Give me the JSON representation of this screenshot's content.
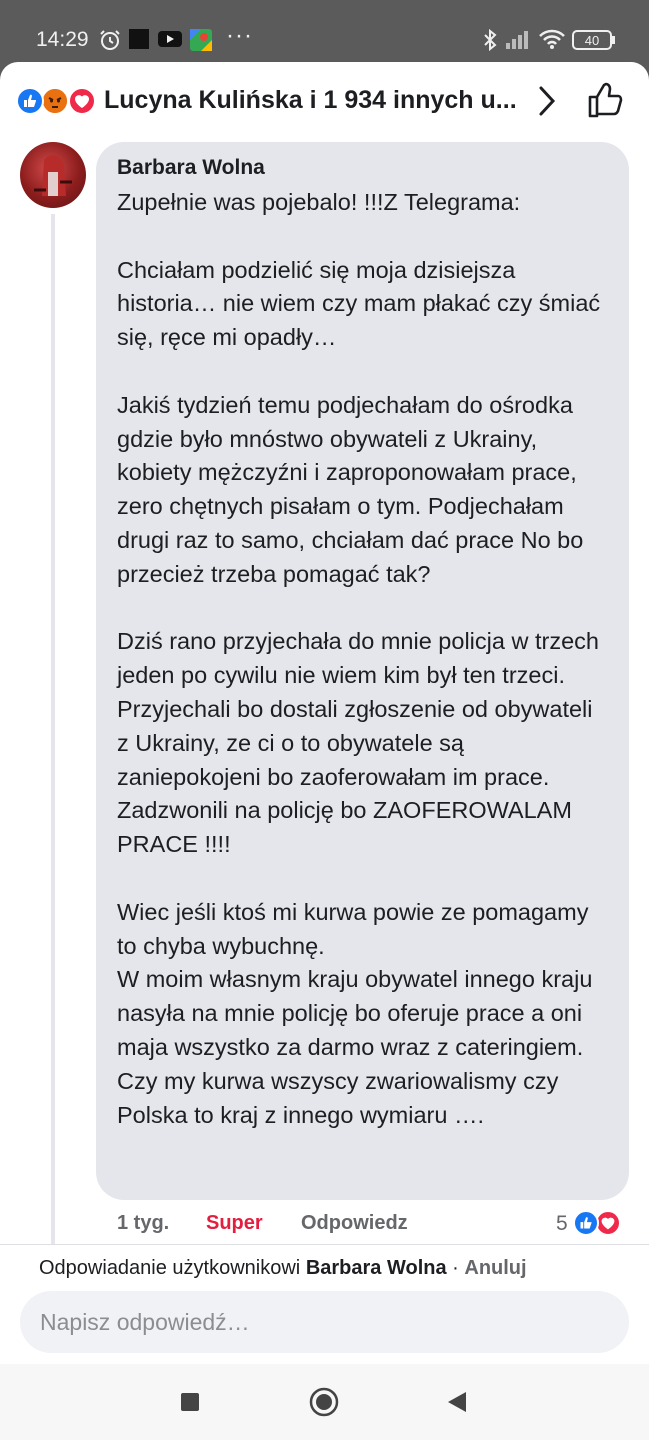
{
  "status_bar": {
    "time": "14:29",
    "dots": "···",
    "battery": "40",
    "icons": [
      "alarm-icon",
      "notification-square-icon",
      "youtube-icon",
      "maps-icon",
      "bluetooth-icon",
      "signal-icon",
      "wifi-icon",
      "battery-icon"
    ]
  },
  "header": {
    "title": "Lucyna Kulińska i 1 934 innych u...",
    "reaction_icons": [
      "like-reaction-icon",
      "angry-reaction-icon",
      "love-reaction-icon"
    ]
  },
  "comment": {
    "author": "Barbara Wolna",
    "text": "Zupełnie was pojebalo! !!!Z Telegrama:\n\nChciałam podzielić się moja dzisiejsza historia… nie wiem czy mam płakać czy śmiać się, ręce mi opadły…\n\nJakiś tydzień temu podjechałam do ośrodka gdzie było mnóstwo obywateli z Ukrainy, kobiety mężczyźni i zaproponowałam prace, zero chętnych pisałam o tym. Podjechałam drugi raz to samo, chciałam dać prace No bo przecież trzeba pomagać tak?\n\nDziś rano przyjechała do mnie policja w trzech jeden po cywilu nie wiem kim był ten trzeci. Przyjechali bo dostali zgłoszenie od obywateli z Ukrainy, ze ci o to obywatele są zaniepokojeni bo zaoferowałam im prace. Zadzwonili na policję bo ZAOFEROWALAM PRACE !!!!\n\nWiec jeśli ktoś mi kurwa powie ze pomagamy to chyba wybuchnę.\nW moim własnym kraju obywatel innego kraju nasyła na mnie policję bo oferuje prace a oni maja wszystko za darmo wraz z cateringiem. Czy my kurwa wszyscy zwariowalismy czy Polska to kraj z innego wymiaru ….",
    "time": "1 tyg.",
    "react_label": "Super",
    "reply_label": "Odpowiedz",
    "reaction_count": "5"
  },
  "reply_bar": {
    "prefix": "Odpowiadanie użytkownikowi",
    "user": "Barbara Wolna",
    "separator": " · ",
    "cancel": "Anuluj",
    "placeholder": "Napisz odpowiedź…"
  },
  "nav": {
    "buttons": [
      "recents-square-icon",
      "home-circle-icon",
      "back-triangle-icon"
    ]
  },
  "colors": {
    "like": "#1877f2",
    "angry": "#f7714c",
    "love": "#f02849",
    "super_text": "#e41e3f",
    "bubble": "#e4e6eb"
  }
}
